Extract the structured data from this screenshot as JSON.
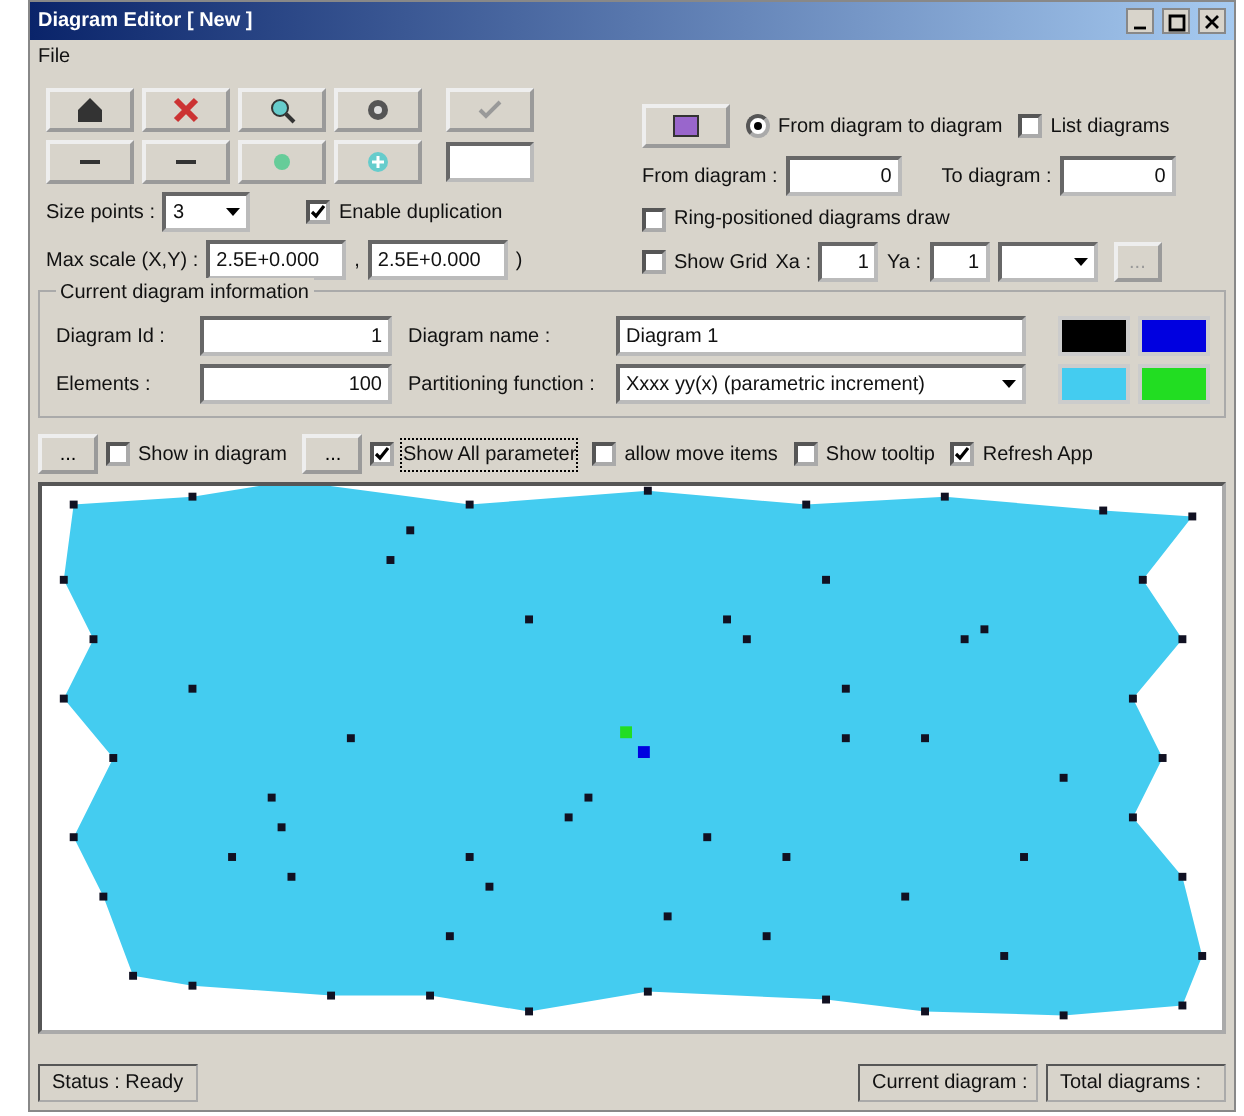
{
  "window": {
    "title": "Diagram Editor [ New ]"
  },
  "menu": [
    "File"
  ],
  "toolbar": {
    "size_label": "Size points :",
    "size_value": "3",
    "duplication": {
      "label": "Enable duplication",
      "checked": true
    },
    "scale_label": "Max scale (X,Y) :",
    "scale_x": "2.5E+0.000",
    "scale_y": "2.5E+0.000",
    "scale_sep": ",",
    "scale_end": ")"
  },
  "navigation": {
    "modes": [
      {
        "label": "From diagram to diagram",
        "selected": true
      },
      {
        "label": "List diagrams",
        "selected": false
      }
    ],
    "from_label": "From diagram :",
    "from_value": "0",
    "to_label": "To diagram :",
    "to_value": "0",
    "ring": {
      "label": "Ring-positioned diagrams draw",
      "checked": false
    }
  },
  "grid": {
    "show": {
      "label": "Show Grid",
      "checked": false
    },
    "xa_label": "Xa :",
    "xa_value": "1",
    "ya_label": "Ya :",
    "ya_value": "1",
    "button": "..."
  },
  "info": {
    "title": "Current diagram information",
    "id_label": "Diagram Id :",
    "id_value": "1",
    "elements_label": "Elements :",
    "elements_value": "100",
    "name_label": "Diagram name :",
    "name_value": "Diagram 1",
    "function_label": "Partitioning function :",
    "function_value": "Xxxx yy(x) (parametric increment)",
    "colors": [
      {
        "color": "#000000"
      },
      {
        "color": "#0000e0"
      },
      {
        "color": "#44ccf0"
      },
      {
        "color": "#22dd22"
      }
    ]
  },
  "options": [
    {
      "kind": "button",
      "label": "..."
    },
    {
      "kind": "check",
      "label": "Show in diagram",
      "checked": false
    },
    {
      "kind": "button",
      "label": "..."
    },
    {
      "kind": "check",
      "label": "Show All parameter",
      "checked": true
    },
    {
      "kind": "check",
      "label": "allow move items",
      "checked": false
    },
    {
      "kind": "check",
      "label": "Show tooltip",
      "checked": false
    },
    {
      "kind": "check",
      "label": "Refresh App",
      "checked": true
    }
  ],
  "status_bar": {
    "status": "Status : Ready",
    "current": "Current diagram :",
    "total": "Total diagrams :"
  }
}
